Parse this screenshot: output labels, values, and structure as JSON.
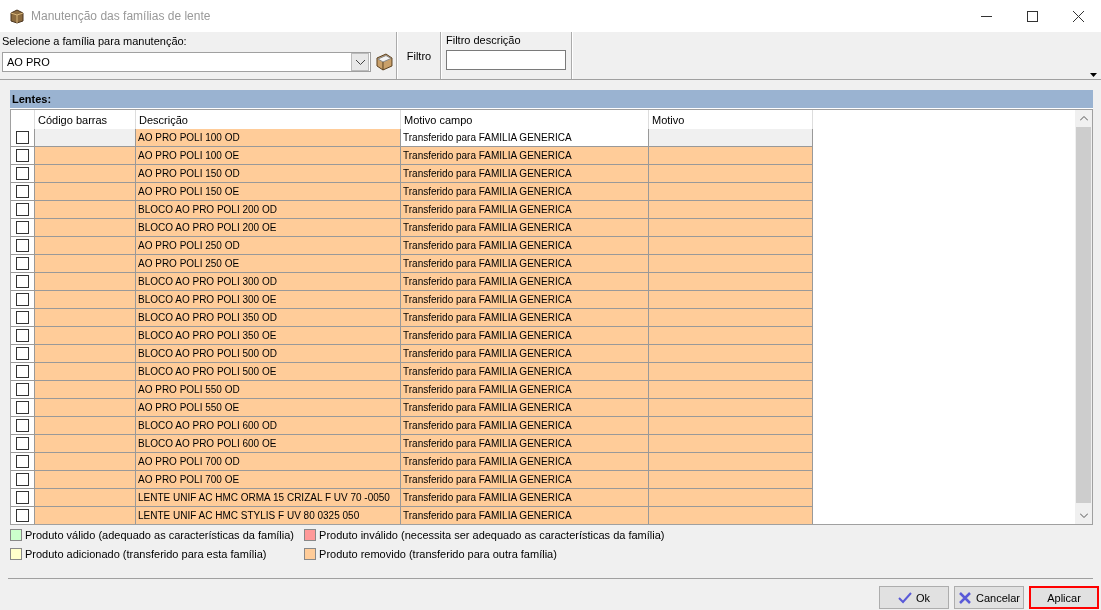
{
  "window": {
    "title": "Manutenção das famílias de lente"
  },
  "family": {
    "label": "Selecione a família para manutenção:",
    "value": "AO PRO"
  },
  "filter": {
    "label": "Filtro",
    "field_label": "Filtro descrição"
  },
  "table": {
    "title": "Lentes:",
    "columns": [
      "Código barras",
      "Descrição",
      "Motivo campo",
      "Motivo"
    ],
    "rows": [
      {
        "description": "AO PRO POLI 100 OD",
        "reason": "Transferido para FAMILIA GENERICA",
        "color": "#ffcc99",
        "checked": false,
        "selected": true
      },
      {
        "description": "AO PRO POLI 100 OE",
        "reason": "Transferido para FAMILIA GENERICA",
        "color": "#ffcc99",
        "checked": false,
        "selected": false
      },
      {
        "description": "AO PRO POLI 150 OD",
        "reason": "Transferido para FAMILIA GENERICA",
        "color": "#ffcc99",
        "checked": false,
        "selected": false
      },
      {
        "description": "AO PRO POLI 150 OE",
        "reason": "Transferido para FAMILIA GENERICA",
        "color": "#ffcc99",
        "checked": false,
        "selected": false
      },
      {
        "description": "BLOCO AO PRO POLI 200 OD",
        "reason": "Transferido para FAMILIA GENERICA",
        "color": "#ffcc99",
        "checked": false,
        "selected": false
      },
      {
        "description": "BLOCO AO PRO POLI 200 OE",
        "reason": "Transferido para FAMILIA GENERICA",
        "color": "#ffcc99",
        "checked": false,
        "selected": false
      },
      {
        "description": "AO PRO POLI 250 OD",
        "reason": "Transferido para FAMILIA GENERICA",
        "color": "#ffcc99",
        "checked": false,
        "selected": false
      },
      {
        "description": "AO PRO POLI 250 OE",
        "reason": "Transferido para FAMILIA GENERICA",
        "color": "#ffcc99",
        "checked": false,
        "selected": false
      },
      {
        "description": "BLOCO AO PRO POLI 300 OD",
        "reason": "Transferido para FAMILIA GENERICA",
        "color": "#ffcc99",
        "checked": false,
        "selected": false
      },
      {
        "description": "BLOCO AO PRO POLI 300 OE",
        "reason": "Transferido para FAMILIA GENERICA",
        "color": "#ffcc99",
        "checked": false,
        "selected": false
      },
      {
        "description": "BLOCO AO PRO POLI 350 OD",
        "reason": "Transferido para FAMILIA GENERICA",
        "color": "#ffcc99",
        "checked": false,
        "selected": false
      },
      {
        "description": "BLOCO AO PRO POLI 350 OE",
        "reason": "Transferido para FAMILIA GENERICA",
        "color": "#ffcc99",
        "checked": false,
        "selected": false
      },
      {
        "description": "BLOCO AO PRO POLI 500 OD",
        "reason": "Transferido para FAMILIA GENERICA",
        "color": "#ffcc99",
        "checked": false,
        "selected": false
      },
      {
        "description": "BLOCO AO PRO POLI 500 OE",
        "reason": "Transferido para FAMILIA GENERICA",
        "color": "#ffcc99",
        "checked": false,
        "selected": false
      },
      {
        "description": "AO PRO POLI 550 OD",
        "reason": "Transferido para FAMILIA GENERICA",
        "color": "#ffcc99",
        "checked": false,
        "selected": false
      },
      {
        "description": "AO PRO POLI 550 OE",
        "reason": "Transferido para FAMILIA GENERICA",
        "color": "#ffcc99",
        "checked": false,
        "selected": false
      },
      {
        "description": "BLOCO AO PRO POLI 600 OD",
        "reason": "Transferido para FAMILIA GENERICA",
        "color": "#ffcc99",
        "checked": false,
        "selected": false
      },
      {
        "description": "BLOCO AO PRO POLI 600 OE",
        "reason": "Transferido para FAMILIA GENERICA",
        "color": "#ffcc99",
        "checked": false,
        "selected": false
      },
      {
        "description": "AO PRO POLI 700 OD",
        "reason": "Transferido para FAMILIA GENERICA",
        "color": "#ffcc99",
        "checked": false,
        "selected": false
      },
      {
        "description": "AO PRO POLI 700 OE",
        "reason": "Transferido para FAMILIA GENERICA",
        "color": "#ffcc99",
        "checked": false,
        "selected": false
      },
      {
        "description": "LENTE UNIF AC HMC ORMA 15 CRIZAL F UV 70 -0050",
        "reason": "Transferido para FAMILIA GENERICA",
        "color": "#ffcc99",
        "checked": false,
        "selected": false
      },
      {
        "description": "LENTE UNIF AC HMC STYLIS F UV 80 0325 050",
        "reason": "Transferido para FAMILIA GENERICA",
        "color": "#ffcc99",
        "checked": false,
        "selected": false
      }
    ]
  },
  "legend": [
    {
      "label": "Produto válido (adequado as características da família)",
      "color": "#ccffcc"
    },
    {
      "label": "Produto inválido (necessita ser adequado as características da família)",
      "color": "#ff9999"
    },
    {
      "label": "Produto adicionado (transferido para esta família)",
      "color": "#ffffcc"
    },
    {
      "label": "Produto removido (transferido para outra família)",
      "color": "#ffcc99"
    }
  ],
  "buttons": [
    {
      "label": "Ok",
      "kind": "ok",
      "focused": false
    },
    {
      "label": "Cancelar",
      "kind": "cancel",
      "focused": false
    },
    {
      "label": "Aplicar",
      "kind": "apply",
      "focused": true
    }
  ]
}
